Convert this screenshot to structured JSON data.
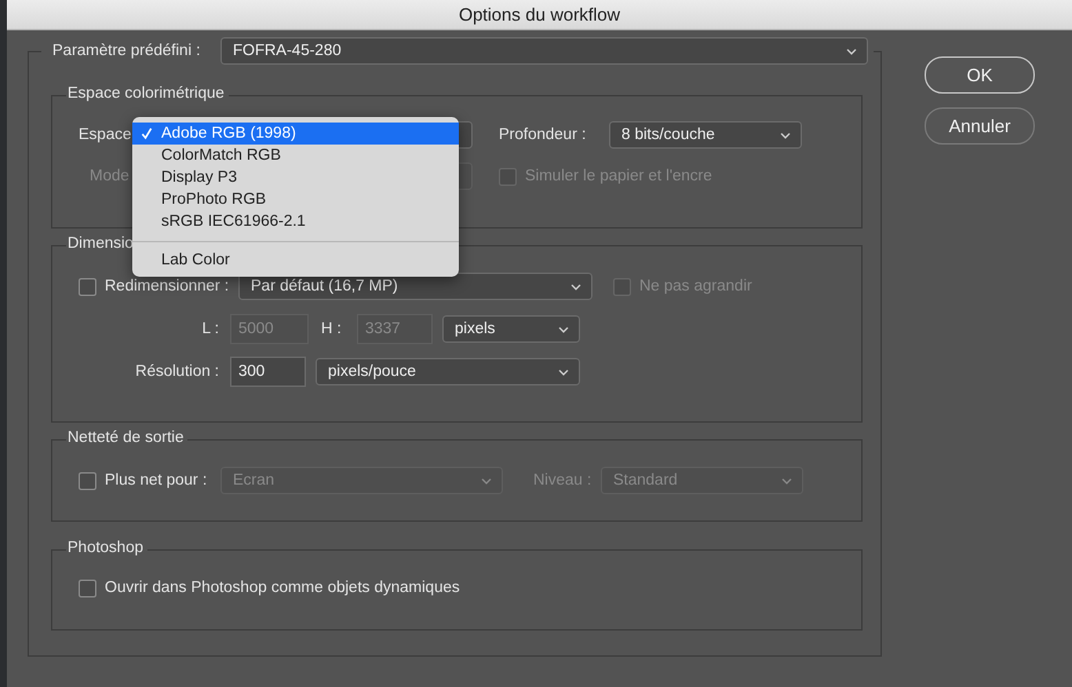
{
  "window": {
    "title": "Options du workflow"
  },
  "preset": {
    "label": "Paramètre prédéfini :",
    "value": "FOFRA-45-280"
  },
  "color_space": {
    "title": "Espace colorimétrique",
    "space_label": "Espace",
    "mode_label": "Mode",
    "mode_disabled": true,
    "depth_label": "Profondeur :",
    "depth_value": "8 bits/couche",
    "simulate": {
      "label": "Simuler le papier et l'encre",
      "checked": false,
      "disabled": true
    }
  },
  "space_menu": {
    "groups": [
      [
        {
          "label": "Adobe RGB (1998)",
          "selected": true
        },
        {
          "label": "ColorMatch RGB",
          "selected": false
        },
        {
          "label": "Display P3",
          "selected": false
        },
        {
          "label": "ProPhoto RGB",
          "selected": false
        },
        {
          "label": "sRGB IEC61966-2.1",
          "selected": false
        }
      ],
      [
        {
          "label": "Lab Color",
          "selected": false
        }
      ]
    ]
  },
  "dimensions": {
    "title": "Dimensio",
    "resize": {
      "label": "Redimensionner :",
      "checked": false,
      "value": "Par défaut (16,7 MP)"
    },
    "no_enlarge": {
      "label": "Ne pas agrandir",
      "checked": false,
      "disabled": true
    },
    "width": {
      "label": "L :",
      "value": "5000",
      "disabled": true
    },
    "height": {
      "label": "H :",
      "value": "3337",
      "disabled": true
    },
    "unit": "pixels",
    "resolution": {
      "label": "Résolution :",
      "value": "300",
      "unit": "pixels/pouce"
    }
  },
  "sharpening": {
    "title": "Netteté de sortie",
    "sharpen": {
      "label": "Plus net pour :",
      "checked": false,
      "value": "Ecran",
      "disabled": true
    },
    "level": {
      "label": "Niveau :",
      "value": "Standard",
      "disabled": true
    }
  },
  "photoshop": {
    "title": "Photoshop",
    "smart_objects": {
      "label": "Ouvrir dans Photoshop comme objets dynamiques",
      "checked": false
    }
  },
  "buttons": [
    {
      "label": "OK",
      "default": true
    },
    {
      "label": "Annuler",
      "default": false
    }
  ]
}
